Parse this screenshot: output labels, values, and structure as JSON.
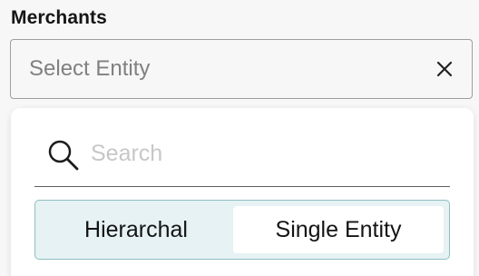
{
  "field": {
    "label": "Merchants",
    "placeholder": "Select Entity"
  },
  "icons": {
    "clear": "close-icon",
    "search": "search-icon"
  },
  "dropdown": {
    "search": {
      "placeholder": "Search",
      "value": ""
    },
    "toggle": {
      "options": [
        {
          "label": "Hierarchal",
          "selected": false
        },
        {
          "label": "Single Entity",
          "selected": true
        }
      ]
    }
  },
  "colors": {
    "toggle_bg": "#e6f2f3",
    "toggle_border": "#8fbfc4",
    "selected_option_bg": "#ffffff",
    "placeholder_text": "#808080"
  }
}
